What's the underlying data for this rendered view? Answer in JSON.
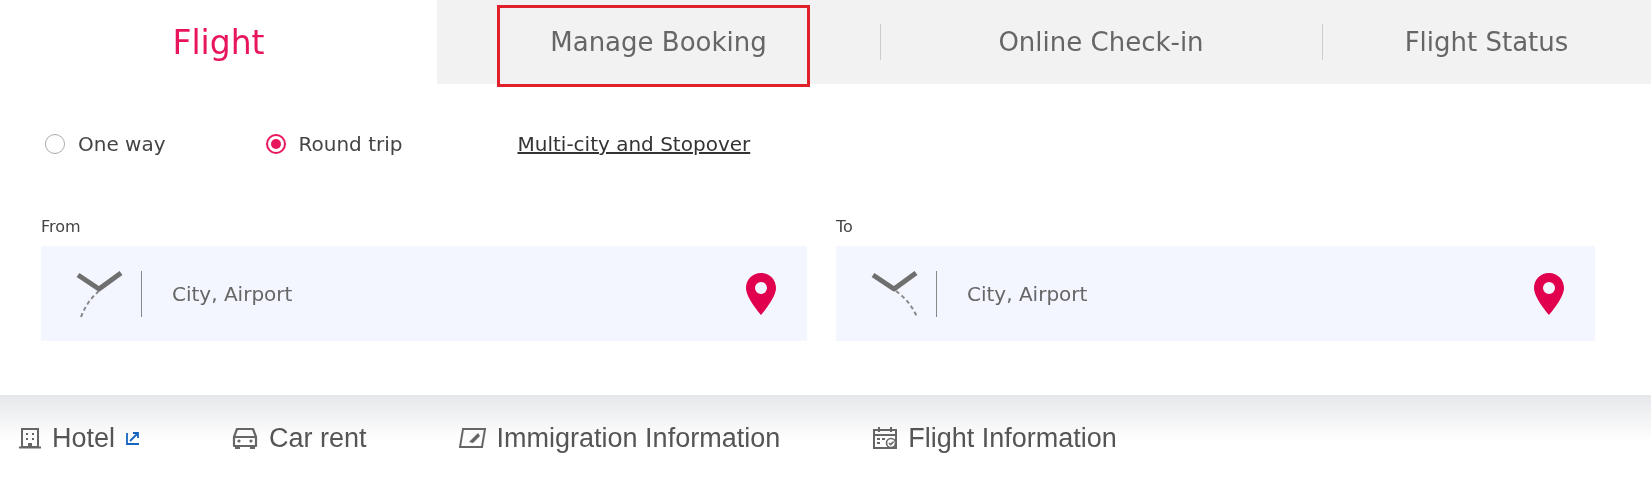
{
  "tabs": [
    {
      "label": "Flight",
      "selected": true,
      "highlighted": false
    },
    {
      "label": "Manage Booking",
      "selected": false,
      "highlighted": true
    },
    {
      "label": "Online Check-in",
      "selected": false,
      "highlighted": false
    },
    {
      "label": "Flight Status",
      "selected": false,
      "highlighted": false
    }
  ],
  "trip_types": [
    {
      "label": "One way",
      "selected": false
    },
    {
      "label": "Round trip",
      "selected": true
    }
  ],
  "multi_city_link": "Multi-city and Stopover",
  "fields": [
    {
      "kind": "departure",
      "label": "From",
      "placeholder": "City, Airport"
    },
    {
      "kind": "arrival",
      "label": "To",
      "placeholder": "City, Airport"
    }
  ],
  "services": [
    {
      "kind": "hotel",
      "label": "Hotel",
      "external": true
    },
    {
      "kind": "car",
      "label": "Car rent",
      "external": false
    },
    {
      "kind": "immigration",
      "label": "Immigration Information",
      "external": false
    },
    {
      "kind": "flight-info",
      "label": "Flight Information",
      "external": false
    }
  ]
}
